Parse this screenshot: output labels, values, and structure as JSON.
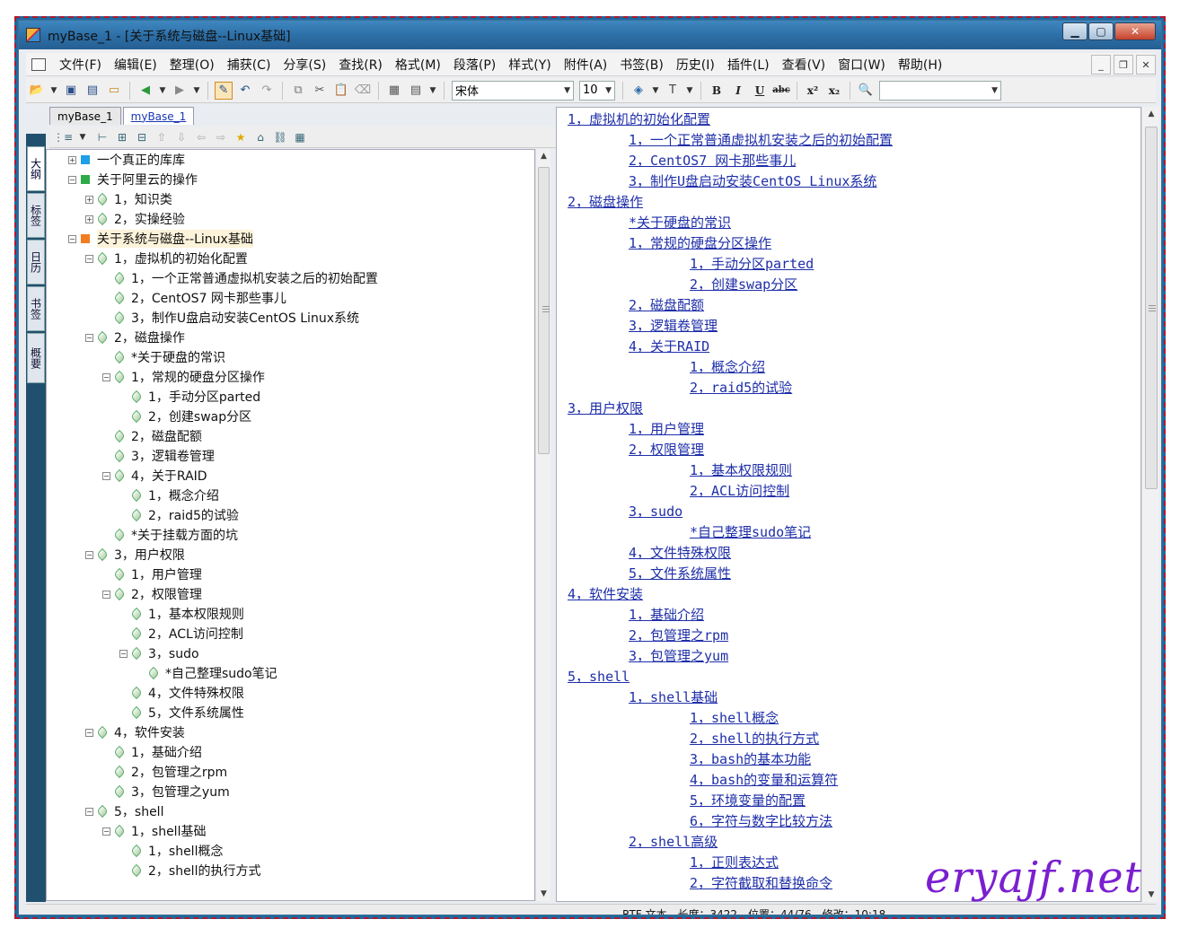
{
  "window": {
    "title": "myBase_1 - [关于系统与磁盘--Linux基础]"
  },
  "menu": [
    "文件(F)",
    "编辑(E)",
    "整理(O)",
    "捕获(C)",
    "分享(S)",
    "查找(R)",
    "格式(M)",
    "段落(P)",
    "样式(Y)",
    "附件(A)",
    "书签(B)",
    "历史(I)",
    "插件(L)",
    "查看(V)",
    "窗口(W)",
    "帮助(H)"
  ],
  "toolbar": {
    "font_name": "宋体",
    "font_size": "10"
  },
  "doc_tabs": [
    "myBase_1",
    "myBase_1"
  ],
  "side_tabs": [
    "大纲",
    "标签",
    "日历",
    "书签",
    "概要"
  ],
  "tree": [
    "一个真正的库库",
    "关于阿里云的操作",
    "1，知识类",
    "2，实操经验",
    "关于系统与磁盘--Linux基础",
    "1，虚拟机的初始化配置",
    "1，一个正常普通虚拟机安装之后的初始配置",
    "2，CentOS7 网卡那些事儿",
    "3，制作U盘启动安装CentOS Linux系统",
    "2，磁盘操作",
    "*关于硬盘的常识",
    "1，常规的硬盘分区操作",
    "1，手动分区parted",
    "2，创建swap分区",
    "2，磁盘配额",
    "3，逻辑卷管理",
    "4，关于RAID",
    "1，概念介绍",
    "2，raid5的试验",
    "*关于挂载方面的坑",
    "3，用户权限",
    "1，用户管理",
    "2，权限管理",
    "1，基本权限规则",
    "2，ACL访问控制",
    "3，sudo",
    "*自己整理sudo笔记",
    "4，文件特殊权限",
    "5，文件系统属性",
    "4，软件安装",
    "1，基础介绍",
    "2，包管理之rpm",
    "3，包管理之yum",
    "5，shell",
    "1，shell基础",
    "1，shell概念",
    "2，shell的执行方式"
  ],
  "editor_lines": [
    "1，虚拟机的初始化配置",
    "1，一个正常普通虚拟机安装之后的初始配置",
    "2，CentOS7 网卡那些事儿",
    "3，制作U盘启动安装CentOS Linux系统",
    "2，磁盘操作",
    "*关于硬盘的常识",
    "1，常规的硬盘分区操作",
    "1，手动分区parted",
    "2，创建swap分区",
    "2，磁盘配额",
    "3，逻辑卷管理",
    "4，关于RAID",
    "1，概念介绍",
    "2，raid5的试验",
    "3，用户权限",
    "1，用户管理",
    "2，权限管理",
    "1，基本权限规则",
    "2，ACL访问控制",
    "3，sudo",
    "*自己整理sudo笔记",
    "4，文件特殊权限",
    "5，文件系统属性",
    "4，软件安装",
    "1，基础介绍",
    "2，包管理之rpm",
    "3，包管理之yum",
    "5，shell",
    "1，shell基础",
    "1，shell概念",
    "2，shell的执行方式",
    "3，bash的基本功能",
    "4，bash的变量和运算符",
    "5，环境变量的配置",
    "6，字符与数字比较方法",
    "2，shell高级",
    "1，正则表达式",
    "2，字符截取和替换命令"
  ],
  "status": {
    "text": "RTF 文本，长度：3422，位置：44/76，修改：10:18"
  },
  "watermark": "eryajf.net"
}
